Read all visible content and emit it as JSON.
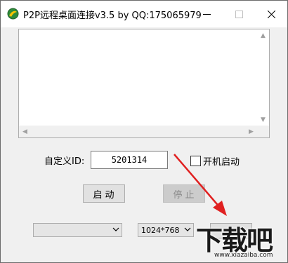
{
  "window": {
    "title": "P2P远程桌面连接v3.5 by QQ:175065979"
  },
  "form": {
    "id_label": "自定义ID:",
    "id_value": "5201314",
    "autostart_label": "开机启动",
    "autostart_checked": false
  },
  "buttons": {
    "start_label": "启动",
    "stop_label": "停止"
  },
  "selects": {
    "first_value": "",
    "resolution_value": "1024*768"
  },
  "watermark": {
    "logo_text": "下载吧",
    "url": "www.xiazaiba.com"
  },
  "colors": {
    "annotation_arrow": "#e02020",
    "window_bg": "#f0f0f0"
  },
  "icons": [
    "app-logo-icon",
    "minimize-icon",
    "maximize-icon",
    "close-icon",
    "scroll-up-icon",
    "scroll-down-icon",
    "scroll-left-icon",
    "scroll-right-icon",
    "dropdown-arrow-icon"
  ]
}
